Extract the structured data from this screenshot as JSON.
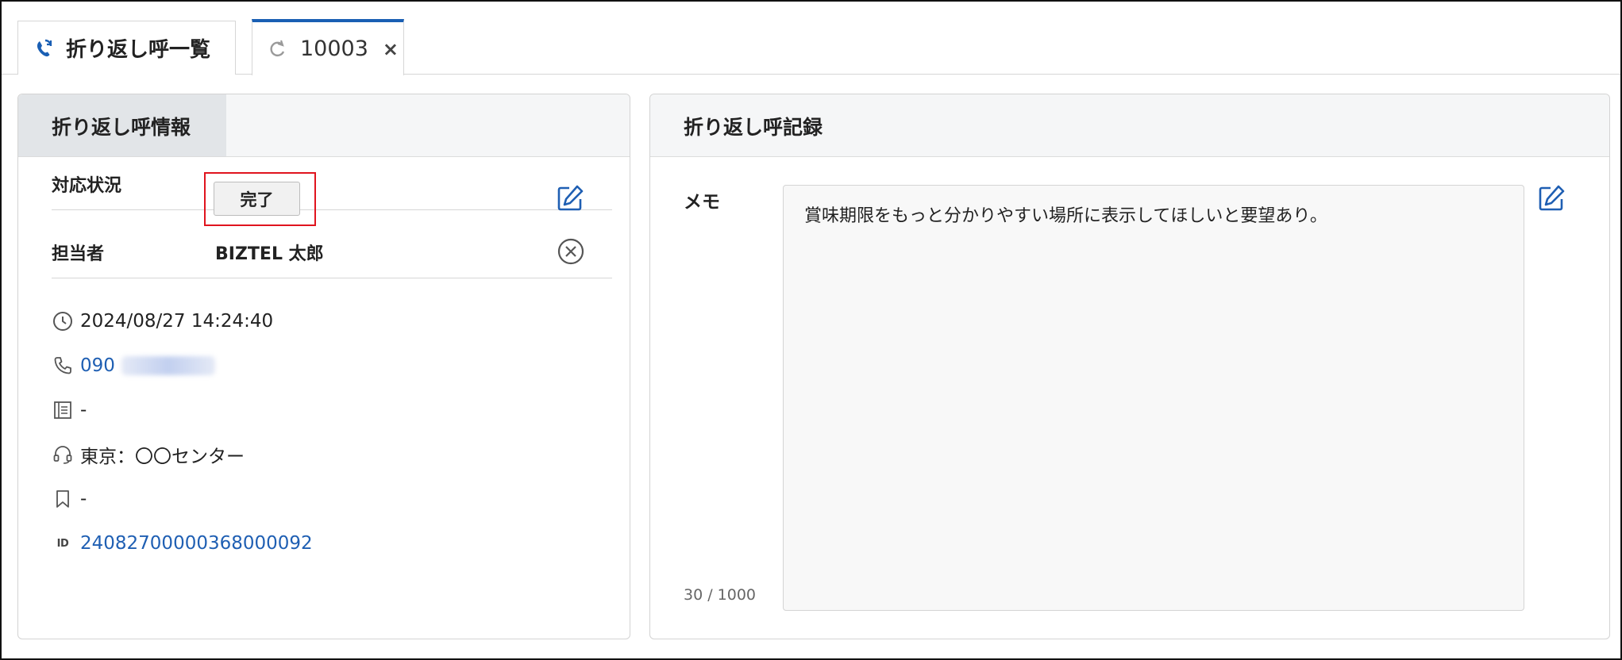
{
  "tabs": [
    {
      "label": "折り返し呼一覧",
      "icon": "callback-phone-icon",
      "active": false
    },
    {
      "label": "10003",
      "icon": "refresh-icon",
      "active": true,
      "closable": true,
      "close_label": "×"
    }
  ],
  "info_panel": {
    "title": "折り返し呼情報",
    "status": {
      "label": "対応状況",
      "value": "完了"
    },
    "assignee": {
      "label": "担当者",
      "value": "BIZTEL 太郎"
    },
    "details": {
      "datetime": "2024/08/27 14:24:40",
      "phone_prefix": "090",
      "category": "-",
      "queue": "東京：〇〇センター",
      "tag": "-",
      "call_id": "24082700000368000092"
    },
    "id_icon_text": "ID"
  },
  "record_panel": {
    "title": "折り返し呼記録",
    "memo_label": "メモ",
    "memo_text": "賞味期限をもっと分かりやすい場所に表示してほしいと要望あり。",
    "char_count": "30 / 1000"
  },
  "colors": {
    "accent": "#1a5fb4",
    "link": "#1f5fb3",
    "highlight_border": "#e0141e"
  }
}
